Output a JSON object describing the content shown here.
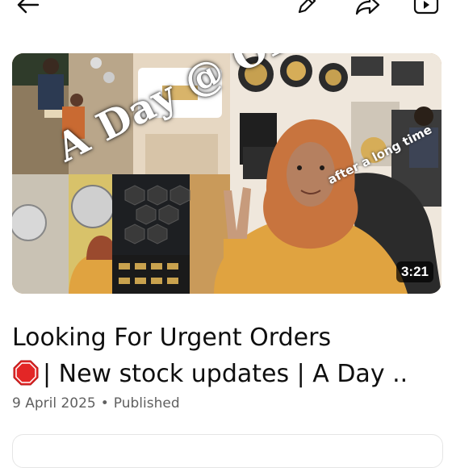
{
  "toolbar": {
    "back_icon": "arrow-left-icon",
    "edit_icon": "pencil-icon",
    "share_icon": "share-icon",
    "play_icon": "youtube-play-icon"
  },
  "video": {
    "thumbnail_text": "A Day @ Office",
    "thumbnail_subtext": "after a long time",
    "duration": "3:21",
    "title_line1": "Looking For Urgent Orders",
    "title_line2": "| New stock updates | A Day ..",
    "date": "9 April 2025",
    "separator": "•",
    "status": "Published"
  },
  "colors": {
    "text_primary": "#0f0f0f",
    "text_secondary": "#606060",
    "stop_sign": "#e32626"
  }
}
